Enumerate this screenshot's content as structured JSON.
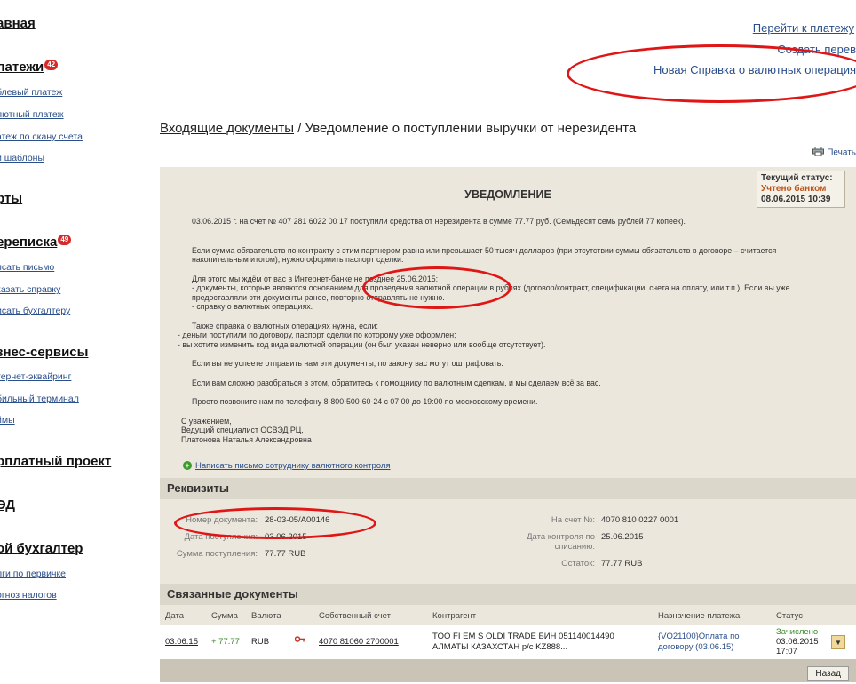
{
  "sidebar": {
    "sections": [
      {
        "label": "авная"
      },
      {
        "label": "латежи",
        "badge": "42",
        "items": [
          "блевый платеж",
          "лютный платеж",
          "атеж по скану счета",
          "и шаблоны"
        ]
      },
      {
        "label": "рты"
      },
      {
        "label": "ереписка",
        "badge": "49",
        "items": [
          "исать письмо",
          "казать справку",
          "исать бухгалтеру"
        ]
      },
      {
        "label": "знес-сервисы",
        "items": [
          "тернет-эквайринг",
          "бильный терминал",
          "ймы"
        ]
      },
      {
        "label": "рплатный проект"
      },
      {
        "label": "ЭД"
      },
      {
        "label": "ой бухгалтер",
        "items": [
          "лги по первичке",
          "огноз налогов"
        ]
      }
    ]
  },
  "top_links": {
    "go_to_payment": "Перейти к платежу",
    "create_transfer": "Создать перев",
    "new_reference": "Новая Справка о валютных операция"
  },
  "breadcrumb": {
    "parent": "Входящие документы",
    "separator": " / ",
    "current": "Уведомление о поступлении выручки от нерезидента"
  },
  "print_label": "Печать",
  "status_box": {
    "label": "Текущий статус:",
    "value": "Учтено банком",
    "date": "08.06.2015 10:39"
  },
  "document": {
    "title": "УВЕДОМЛЕНИЕ",
    "p1": "03.06.2015 г. на счет № 407   281   6022   00   17   поступили средства от нерезидента в сумме 77.77 руб. (Семьдесят семь рублей 77 копеек).",
    "p2": "Если сумма обязательств по контракту с этим партнером равна или превышает 50 тысяч долларов (при отсутствии суммы обязательств в договоре – считается накопительным итогом), нужно оформить паспорт сделки.",
    "p3a": "Для этого мы ждём от вас в Интернет-банке не позднее 25.06.2015:",
    "p3b": "- документы, которые являются основанием для проведения валютной операции в рублях (договор/контракт, спецификации, счета на оплату, или т.п.). Если вы уже предоставляли эти документы ранее, повторно отправлять не нужно.",
    "p3c": "- справку о валютных операциях.",
    "p4a": "Также справка о валютных операциях нужна, если:",
    "p4b": "- деньги поступили по договору, паспорт сделки по которому уже оформлен;",
    "p4c": "- вы хотите изменить код вида валютной операции (он был указан неверно или вообще отсутствует).",
    "p5": "Если вы не успеете отправить нам эти документы, по закону вас могут оштрафовать.",
    "p6": "Если вам сложно разобраться в этом, обратитесь к помощнику по валютным сделкам, и мы сделаем всё за вас.",
    "p7": "Просто позвоните нам по телефону 8-800-500-60-24 с 07:00 до 19:00 по московскому времени.",
    "sig1": "С уважением,",
    "sig2": "Ведущий специалист ОСВЭД РЦ,",
    "sig3": "Платонова Наталья Александровна"
  },
  "write_link": "Написать письмо сотруднику валютного контроля",
  "requisites": {
    "header": "Реквизиты",
    "doc_number_label": "Номер документа:",
    "doc_number": "28-03-05/A00146",
    "receipt_date_label": "Дата поступления:",
    "receipt_date": "03.06.2015",
    "receipt_sum_label": "Сумма поступления:",
    "receipt_sum": "77.77 RUB",
    "account_label": "На счет №:",
    "account": "4070   810   0227   0001",
    "control_date_label": "Дата контроля по списанию:",
    "control_date": "25.06.2015",
    "balance_label": "Остаток:",
    "balance": "77.77 RUB"
  },
  "related": {
    "header": "Связанные документы",
    "columns": [
      "Дата",
      "Сумма",
      "Валюта",
      "Собственный счет",
      "Контрагент",
      "Назначение платежа",
      "Статус"
    ],
    "row": {
      "date": "03.06.15",
      "sum": "+ 77.77",
      "currency": "RUB",
      "account": "4070   81060   2700001",
      "counterparty1": "TOO FI   EM S OLDI TRADE БИН 051140014490",
      "counterparty2": "АЛМАТЫ КАЗАХСТАН р/с KZ888...",
      "purpose1": "{VO21100}Оплата по",
      "purpose2": "договору (03.06.15)",
      "status1": "Зачислено",
      "status2": "03.06.2015",
      "status3": "17:07"
    }
  },
  "back_button": "Назад",
  "colors": {
    "link": "#2a4e8a",
    "panel": "#ebe7dd",
    "annotation": "#e01515",
    "status_accent": "#c0531b"
  }
}
